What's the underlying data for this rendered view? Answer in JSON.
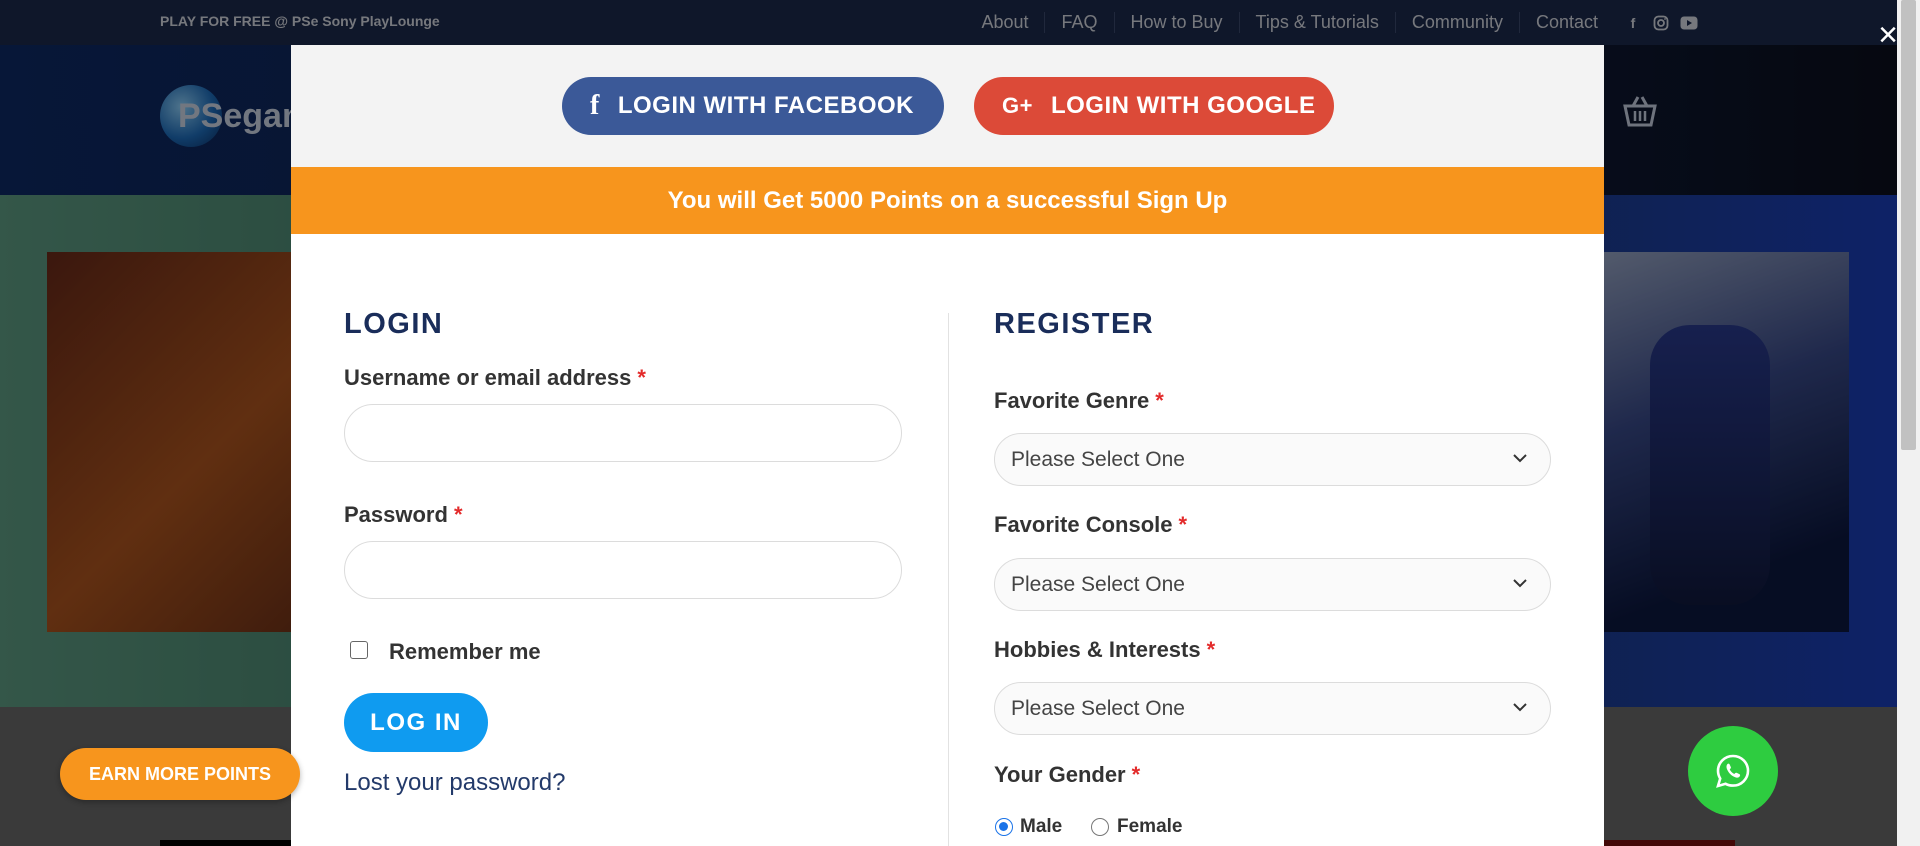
{
  "topbar": {
    "promo": "PLAY FOR FREE @ PSe Sony PlayLounge",
    "nav": [
      "About",
      "FAQ",
      "How to Buy",
      "Tips & Tutorials",
      "Community",
      "Contact"
    ],
    "social_icons": [
      "facebook-icon",
      "instagram-icon",
      "youtube-icon"
    ]
  },
  "header": {
    "logo_text": "PSegam"
  },
  "modal": {
    "facebook_label": "LOGIN WITH FACEBOOK",
    "google_label": "LOGIN WITH GOOGLE",
    "points_banner": "You will Get 5000 Points on a successful Sign Up",
    "login": {
      "title": "LOGIN",
      "username_label": "Username or email address",
      "password_label": "Password",
      "required_mark": "*",
      "remember_label": "Remember me",
      "button_label": "LOG IN",
      "lost_password": "Lost your password?"
    },
    "register": {
      "title": "REGISTER",
      "genre_label": "Favorite Genre",
      "console_label": "Favorite Console",
      "hobbies_label": "Hobbies & Interests",
      "gender_label": "Your Gender",
      "select_placeholder": "Please Select One",
      "gender_options": [
        "Male",
        "Female"
      ],
      "gender_selected": "Male"
    }
  },
  "floating": {
    "earn_points": "EARN MORE POINTS"
  },
  "colors": {
    "orange": "#f7951d",
    "facebook": "#3b5998",
    "google": "#dc4a38",
    "login_button": "#0f9bf0",
    "whatsapp": "#2ecc40",
    "heading": "#1a2d5a"
  }
}
